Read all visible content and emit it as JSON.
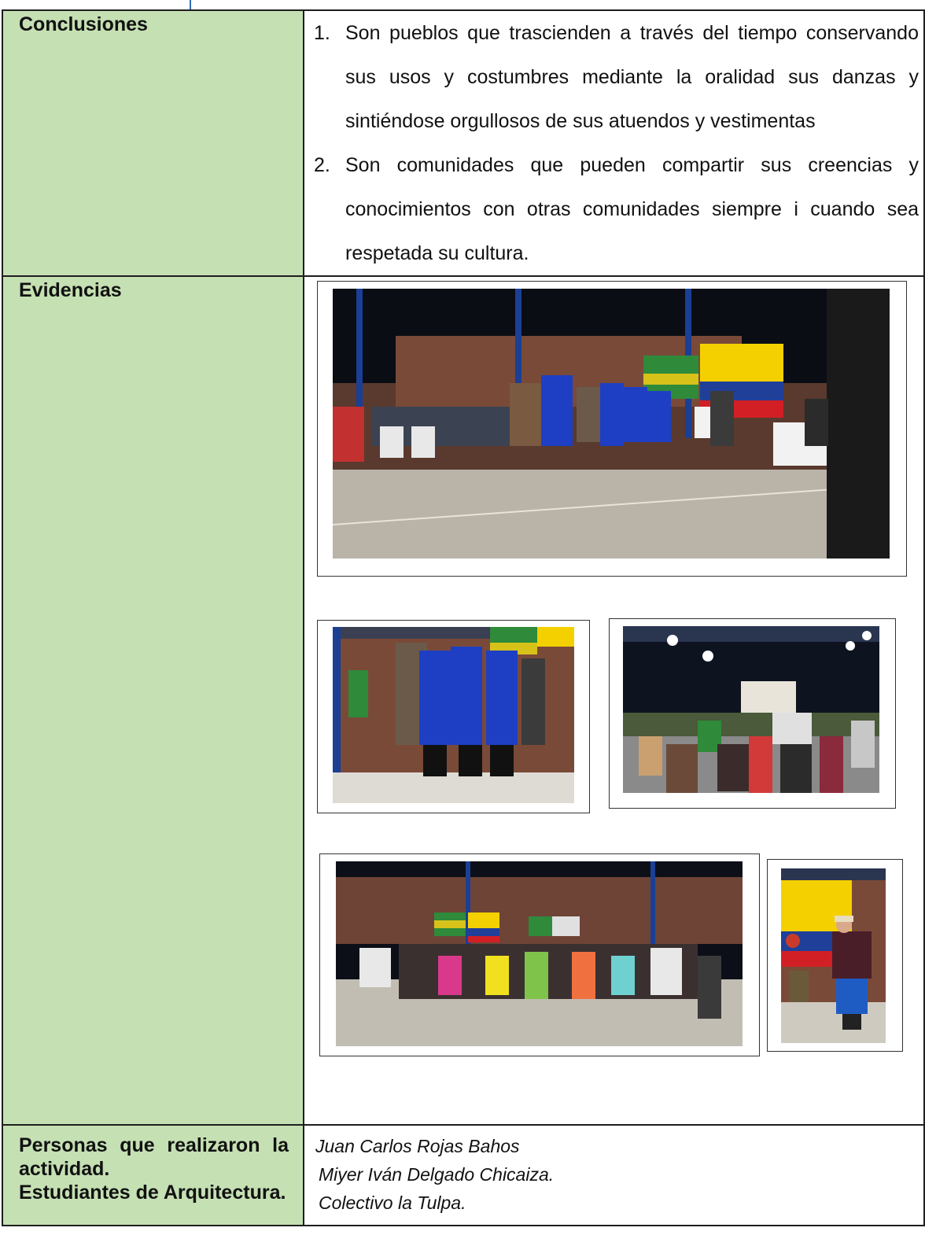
{
  "conclusions": {
    "label": "Conclusiones",
    "items": [
      {
        "num": "1.",
        "text": "Son pueblos que trascienden a través del tiempo conservando sus usos y costumbres mediante la oralidad sus danzas y sintiéndose orgullosos de sus atuendos y vestimentas"
      },
      {
        "num": "2.",
        "text": "Son comunidades que pueden compartir sus creencias y conocimientos con otras comunidades siempre i cuando sea respetada su cultura."
      }
    ]
  },
  "evidencias": {
    "label": "Evidencias",
    "photos": [
      {
        "name": "photo-dance-performance-wide"
      },
      {
        "name": "photo-dancers-closeup"
      },
      {
        "name": "photo-crowd-night-field"
      },
      {
        "name": "photo-community-gathering"
      },
      {
        "name": "photo-speaker-with-flag"
      }
    ]
  },
  "personas": {
    "label_line1": "Personas que realizaron la",
    "label_line2": "actividad.",
    "label_line3": "Estudiantes de Arquitectura.",
    "names": [
      "Juan Carlos Rojas Bahos",
      "Miyer Iván Delgado Chicaiza.",
      "Colectivo la Tulpa."
    ]
  },
  "colors": {
    "label_bg": "#c5e0b3",
    "border": "#1e1e1e",
    "flag_yellow": "#f5d000",
    "flag_blue": "#1f3f99",
    "flag_red": "#d21f26",
    "poncho_blue": "#1e3fc4"
  }
}
